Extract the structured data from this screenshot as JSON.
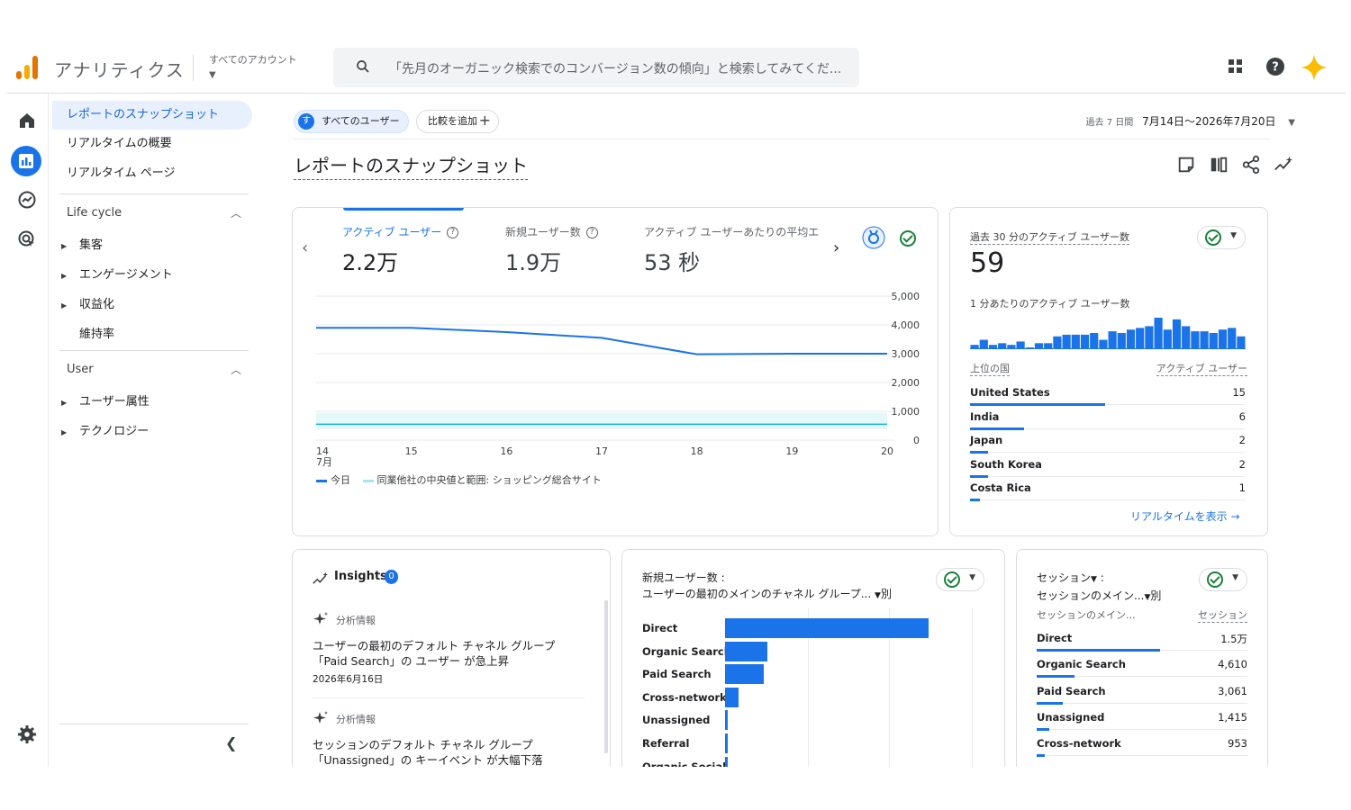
{
  "topbar": {
    "app_title": "アナリティクス",
    "account_label": "すべてのアカウント",
    "search_placeholder": "「先月のオーガニック検索でのコンバージョン数の傾向」と検索してみてくだ..."
  },
  "sidebar": {
    "items": [
      {
        "label": "レポートのスナップショット",
        "active": true
      },
      {
        "label": "リアルタイムの概要"
      },
      {
        "label": "リアルタイム ページ"
      }
    ],
    "lifecycle": {
      "title": "Life cycle",
      "items": [
        "集客",
        "エンゲージメント",
        "収益化",
        "維持率"
      ]
    },
    "user": {
      "title": "User",
      "items": [
        "ユーザー属性",
        "テクノロジー"
      ]
    }
  },
  "header": {
    "chip_users": "すべてのユーザー",
    "chip_users_avatar": "す",
    "chip_compare": "比較を追加",
    "date_prefix": "過去 7 日間",
    "date_range": "7月14日～2026年7月20日",
    "page_title": "レポートのスナップショット"
  },
  "metrics": [
    {
      "label": "アクティブ ユーザー",
      "value": "2.2万",
      "active": true
    },
    {
      "label": "新規ユーザー数",
      "value": "1.9万"
    },
    {
      "label": "アクティブ ユーザーあたりの平均エ",
      "value": "53 秒"
    }
  ],
  "chart_data": {
    "type": "line",
    "x": [
      "14",
      "15",
      "16",
      "17",
      "18",
      "19",
      "20"
    ],
    "x_month_label": "7月",
    "series": [
      {
        "name": "今日",
        "values": [
          3900,
          3900,
          3750,
          3550,
          2980,
          3000,
          3000
        ],
        "color": "#1a73e8"
      },
      {
        "name": "同業他社の中央値と範囲: ショッピング総合サイト",
        "values": [
          550,
          550,
          550,
          550,
          550,
          550,
          550
        ],
        "band": [
          380,
          950
        ],
        "color": "#12b5cb"
      }
    ],
    "y_ticks": [
      "5,000",
      "4,000",
      "3,000",
      "2,000",
      "1,000",
      "0"
    ],
    "ylim": [
      0,
      5000
    ]
  },
  "realtime": {
    "title": "過去 30 分のアクティブ ユーザー数",
    "value": "59",
    "per_minute_label": "1 分あたりのアクティブ ユーザー数",
    "per_minute": [
      2,
      5,
      2,
      3,
      2,
      4,
      0,
      3,
      3,
      7,
      8,
      8,
      8,
      9,
      5,
      10,
      9,
      11,
      12,
      13,
      18,
      11,
      17,
      13,
      10,
      10,
      9,
      11,
      12,
      7
    ],
    "col_country": "上位の国",
    "col_users": "アクティブ ユーザー",
    "rows": [
      {
        "country": "United States",
        "value": "15",
        "frac": 1.0
      },
      {
        "country": "India",
        "value": "6",
        "frac": 0.4
      },
      {
        "country": "Japan",
        "value": "2",
        "frac": 0.13
      },
      {
        "country": "South Korea",
        "value": "2",
        "frac": 0.13
      },
      {
        "country": "Costa Rica",
        "value": "1",
        "frac": 0.07
      }
    ],
    "link": "リアルタイムを表示"
  },
  "insights": {
    "title": "Insights",
    "count": "0",
    "items": [
      {
        "tag": "分析情報",
        "line1": "ユーザーの最初のデフォルト チャネル グループ",
        "line2": "「Paid Search」の ユーザー が急上昇",
        "date": "2026年6月16日"
      },
      {
        "tag": "分析情報",
        "line1": "セッションのデフォルト チャネル グループ",
        "line2": "「Unassigned」の キーイベント が大幅下落",
        "date": ""
      }
    ]
  },
  "new_users_card": {
    "title1": "新規ユーザー数 :",
    "title2": "ユーザーの最初のメインのチャネル グループ...",
    "title2_suffix": "別",
    "categories": [
      "Direct",
      "Organic Search",
      "Paid Search",
      "Cross-network",
      "Unassigned",
      "Referral",
      "Organic Social"
    ],
    "fractions": [
      1.0,
      0.21,
      0.19,
      0.065,
      0.015,
      0.015,
      0.01
    ]
  },
  "sessions_card": {
    "title1": "セッション",
    "title1_suffix": " :",
    "title2": "セッションのメイン...",
    "title2_suffix": "別",
    "col1": "セッションのメイン...",
    "col2": "セッション",
    "rows": [
      {
        "label": "Direct",
        "value": "1.5万",
        "frac": 1.0
      },
      {
        "label": "Organic Search",
        "value": "4,610",
        "frac": 0.31
      },
      {
        "label": "Paid Search",
        "value": "3,061",
        "frac": 0.21
      },
      {
        "label": "Unassigned",
        "value": "1,415",
        "frac": 0.1
      },
      {
        "label": "Cross-network",
        "value": "953",
        "frac": 0.065
      }
    ]
  }
}
